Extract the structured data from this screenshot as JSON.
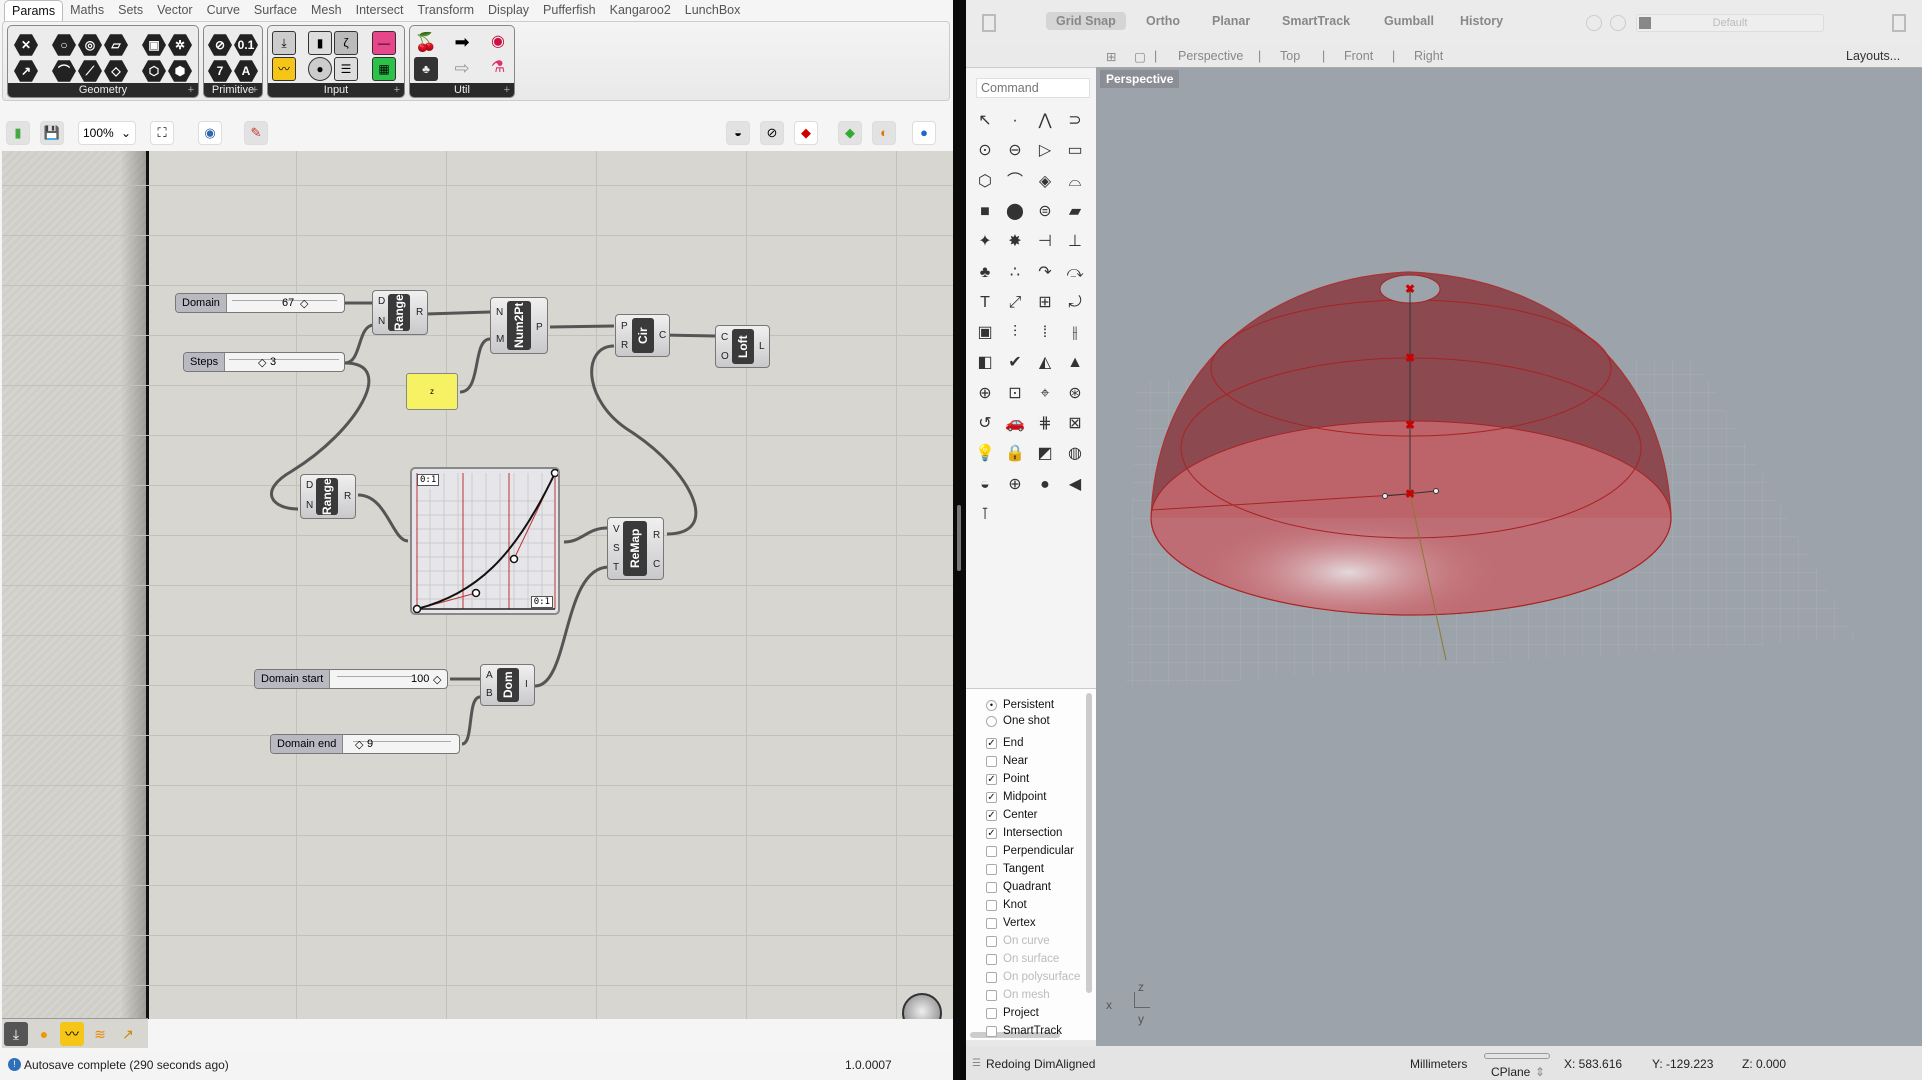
{
  "grasshopper": {
    "tabs": [
      "Params",
      "Maths",
      "Sets",
      "Vector",
      "Curve",
      "Surface",
      "Mesh",
      "Intersect",
      "Transform",
      "Display",
      "Pufferfish",
      "Kangaroo2",
      "LunchBox"
    ],
    "active_tab": "Params",
    "ribbon_groups": [
      {
        "label": "Geometry"
      },
      {
        "label": "Primitive"
      },
      {
        "label": "Input"
      },
      {
        "label": "Util"
      }
    ],
    "toolbar": {
      "zoom": "100%",
      "icons": [
        "open-file-icon",
        "save-icon",
        "zoom-extents-icon",
        "preview-eye-icon",
        "sketch-pen-icon",
        "preview-wireframe-icon",
        "preview-disabled-icon",
        "preview-shaded-icon",
        "bake-icon",
        "material-icon",
        "sphere-icon"
      ]
    },
    "nodes": {
      "domain_slider": {
        "label": "Domain",
        "value": "67"
      },
      "steps_slider": {
        "label": "Steps",
        "value": "3"
      },
      "range1": {
        "name": "Range",
        "inputs": [
          "D",
          "N"
        ],
        "outputs": [
          "R"
        ]
      },
      "num2pt": {
        "name": "Num2Pt",
        "inputs": [
          "N",
          "M"
        ],
        "outputs": [
          "P"
        ]
      },
      "panel": {
        "text": "z"
      },
      "circle": {
        "name": "Cir",
        "inputs": [
          "P",
          "R"
        ],
        "outputs": [
          "C"
        ]
      },
      "loft": {
        "name": "Loft",
        "inputs": [
          "C",
          "O"
        ],
        "outputs": [
          "L"
        ]
      },
      "range2": {
        "name": "Range",
        "inputs": [
          "D",
          "N"
        ],
        "outputs": [
          "R"
        ]
      },
      "graph_mapper": {
        "x_label": "0:1",
        "y_label": "0:1"
      },
      "remap": {
        "name": "ReMap",
        "inputs": [
          "V",
          "S",
          "T"
        ],
        "outputs": [
          "R",
          "C"
        ]
      },
      "domain_start_slider": {
        "label": "Domain start",
        "value": "100"
      },
      "domain_end_slider": {
        "label": "Domain end",
        "value": "9"
      },
      "construct_domain": {
        "name": "Dom",
        "inputs": [
          "A",
          "B"
        ],
        "outputs": [
          "I"
        ]
      }
    },
    "status": {
      "message": "Autosave complete (290 seconds ago)",
      "version": "1.0.0007"
    }
  },
  "rhino": {
    "top_toggles": [
      "Grid Snap",
      "Ortho",
      "Planar",
      "SmartTrack",
      "Gumball",
      "History"
    ],
    "layer": "Default",
    "view_tabs": [
      "Perspective",
      "Top",
      "Front",
      "Right"
    ],
    "layouts": "Layouts...",
    "command_placeholder": "Command",
    "viewport_label": "Perspective",
    "osnap": {
      "mode": [
        {
          "label": "Persistent",
          "selected": true
        },
        {
          "label": "One shot",
          "selected": false
        }
      ],
      "items": [
        {
          "label": "End",
          "checked": true,
          "enabled": true
        },
        {
          "label": "Near",
          "checked": false,
          "enabled": true
        },
        {
          "label": "Point",
          "checked": true,
          "enabled": true
        },
        {
          "label": "Midpoint",
          "checked": true,
          "enabled": true
        },
        {
          "label": "Center",
          "checked": true,
          "enabled": true
        },
        {
          "label": "Intersection",
          "checked": true,
          "enabled": true
        },
        {
          "label": "Perpendicular",
          "checked": false,
          "enabled": true
        },
        {
          "label": "Tangent",
          "checked": false,
          "enabled": true
        },
        {
          "label": "Quadrant",
          "checked": false,
          "enabled": true
        },
        {
          "label": "Knot",
          "checked": false,
          "enabled": true
        },
        {
          "label": "Vertex",
          "checked": false,
          "enabled": true
        },
        {
          "label": "On curve",
          "checked": false,
          "enabled": false
        },
        {
          "label": "On surface",
          "checked": false,
          "enabled": false
        },
        {
          "label": "On polysurface",
          "checked": false,
          "enabled": false
        },
        {
          "label": "On mesh",
          "checked": false,
          "enabled": false
        },
        {
          "label": "Project",
          "checked": false,
          "enabled": true
        },
        {
          "label": "SmartTrack",
          "checked": false,
          "enabled": true
        }
      ]
    },
    "axes": {
      "x": "x",
      "y": "y",
      "z": "z"
    },
    "status": {
      "prompt": "Redoing DimAligned",
      "units": "Millimeters",
      "cplane": "CPlane",
      "x": "X: 583.616",
      "y": "Y: -129.223",
      "z": "Z: 0.000"
    }
  }
}
